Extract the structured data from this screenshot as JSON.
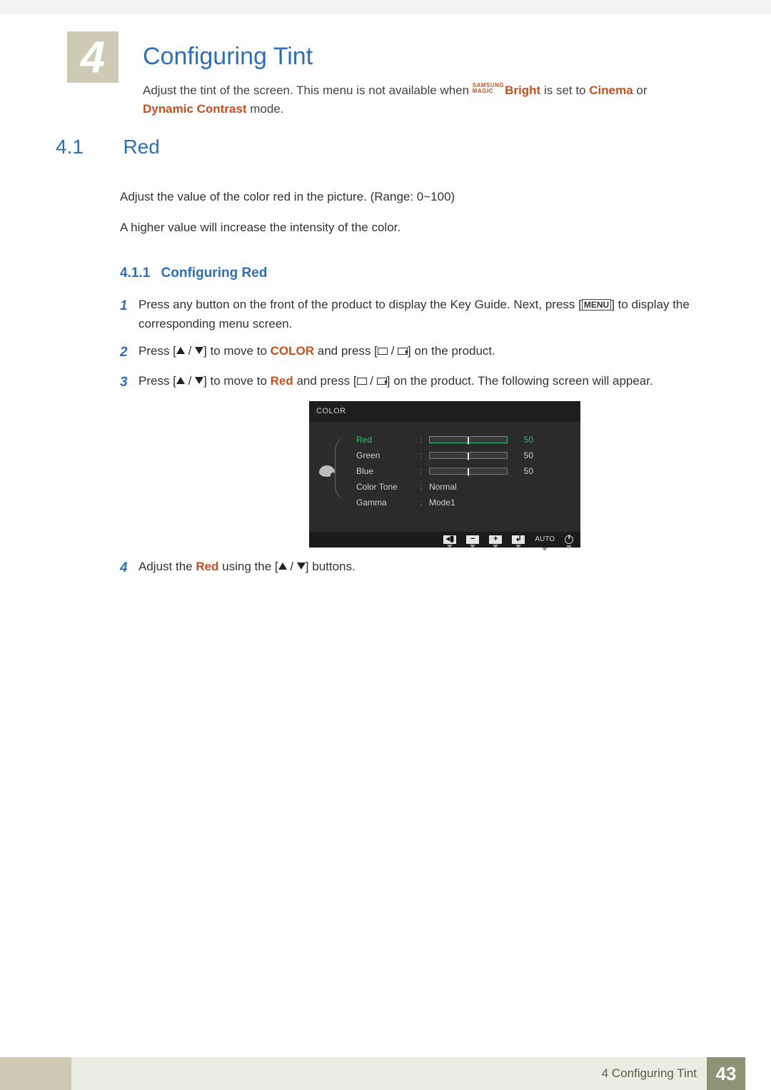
{
  "chapter": {
    "number": "4",
    "title": "Configuring Tint",
    "intro_lead": "Adjust the tint of the screen. This menu is not available when ",
    "magic_top": "SAMSUNG",
    "magic_bottom": "MAGIC",
    "bright": "Bright",
    "intro_mid1": " is set to ",
    "cinema": "Cinema",
    "intro_mid2": " or ",
    "dynamic": "Dynamic Contrast",
    "intro_tail": " mode."
  },
  "section": {
    "num": "4.1",
    "title": "Red",
    "p1": "Adjust the value of the color red in the picture. (Range: 0~100)",
    "p2": "A higher value will increase the intensity of the color."
  },
  "subsection": {
    "num": "4.1.1",
    "title": "Configuring Red"
  },
  "steps": {
    "s1": {
      "num": "1",
      "a": "Press any button on the front of the product to display the Key Guide. Next, press [",
      "menu": "MENU",
      "b": "] to display the corresponding menu screen."
    },
    "s2": {
      "num": "2",
      "a": "Press [",
      "b": "] to move to ",
      "color": "COLOR",
      "c": " and press [",
      "d": "] on the product."
    },
    "s3": {
      "num": "3",
      "a": "Press [",
      "b": "] to move to ",
      "red": "Red",
      "c": " and press [",
      "d": "] on the product. The following screen will appear."
    },
    "s4": {
      "num": "4",
      "a": "Adjust the ",
      "red": "Red",
      "b": " using the [",
      "c": "] buttons."
    }
  },
  "osd": {
    "title": "COLOR",
    "items": {
      "red": "Red",
      "green": "Green",
      "blue": "Blue",
      "colortone": "Color Tone",
      "gamma": "Gamma"
    },
    "values": {
      "red": "50",
      "green": "50",
      "blue": "50",
      "colortone": "Normal",
      "gamma": "Mode1"
    },
    "footer_auto": "AUTO"
  },
  "footer": {
    "label": "4 Configuring Tint",
    "page": "43"
  },
  "chart_data": {
    "type": "table",
    "title": "COLOR OSD menu values",
    "rows": [
      {
        "item": "Red",
        "value": 50,
        "range": [
          0,
          100
        ],
        "selected": true
      },
      {
        "item": "Green",
        "value": 50,
        "range": [
          0,
          100
        ]
      },
      {
        "item": "Blue",
        "value": 50,
        "range": [
          0,
          100
        ]
      },
      {
        "item": "Color Tone",
        "value": "Normal"
      },
      {
        "item": "Gamma",
        "value": "Mode1"
      }
    ]
  }
}
